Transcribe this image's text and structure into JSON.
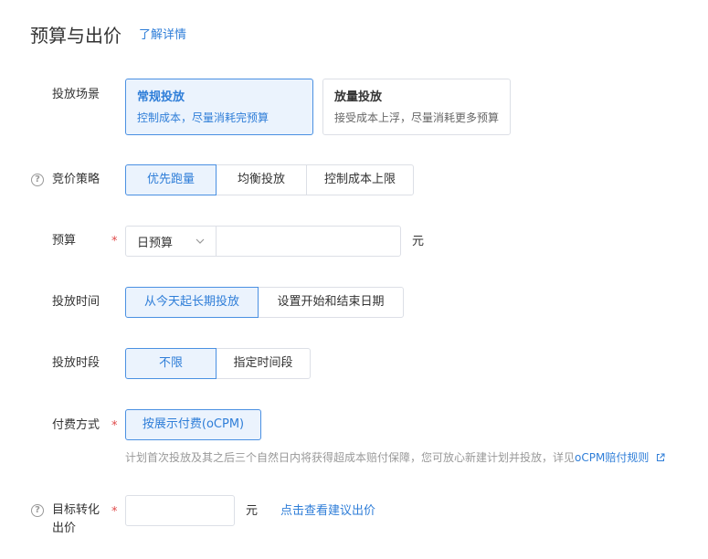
{
  "header": {
    "title": "预算与出价",
    "details_link": "了解详情"
  },
  "scene": {
    "label": "投放场景",
    "options": [
      {
        "title": "常规投放",
        "desc": "控制成本，尽量消耗完预算",
        "selected": true
      },
      {
        "title": "放量投放",
        "desc": "接受成本上浮，尽量消耗更多预算",
        "selected": false
      }
    ]
  },
  "bid_strategy": {
    "label": "竞价策略",
    "options": [
      "优先跑量",
      "均衡投放",
      "控制成本上限"
    ],
    "selected": "优先跑量"
  },
  "budget": {
    "label": "预算",
    "required_mark": "*",
    "type_value": "日预算",
    "amount_value": "",
    "unit": "元"
  },
  "schedule_time": {
    "label": "投放时间",
    "options": [
      "从今天起长期投放",
      "设置开始和结束日期"
    ],
    "selected": "从今天起长期投放"
  },
  "schedule_period": {
    "label": "投放时段",
    "options": [
      "不限",
      "指定时间段"
    ],
    "selected": "不限"
  },
  "billing": {
    "label": "付费方式",
    "required_mark": "*",
    "options": [
      "按展示付费(oCPM)"
    ],
    "selected": "按展示付费(oCPM)",
    "hint": "计划首次投放及其之后三个自然日内将获得超成本赔付保障，您可放心新建计划并投放，详见",
    "hint_link": "oCPM赔付规则"
  },
  "target_bid": {
    "label_line1": "目标转化",
    "label_line2": "出价",
    "required_mark": "*",
    "value": "",
    "unit": "元",
    "suggest_link": "点击查看建议出价"
  }
}
